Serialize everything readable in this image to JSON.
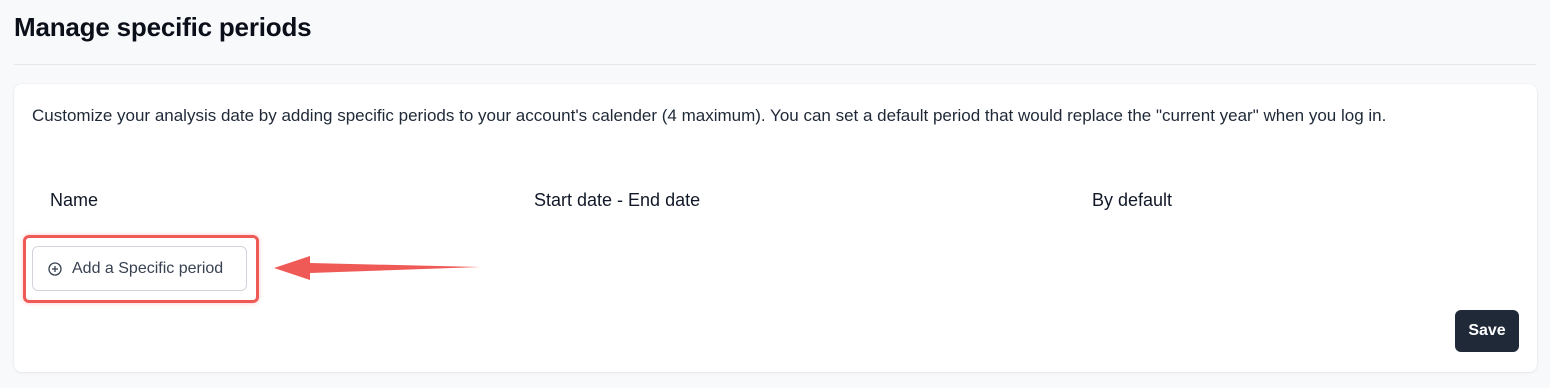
{
  "page": {
    "title": "Manage specific periods"
  },
  "card": {
    "description": "Customize your analysis date by adding specific periods to your account's calender (4 maximum). You can set a default period that would replace the \"current year\" when you log in.",
    "columns": [
      "Name",
      "Start date - End date",
      "By default"
    ],
    "add_button": {
      "label": "Add a Specific period",
      "icon": "plus-circle-icon"
    },
    "save_label": "Save"
  },
  "annotation": {
    "highlight_color": "#ef5a57",
    "arrow_icon": "arrow-left-icon"
  },
  "colors": {
    "background": "#f8f9fb",
    "card": "#ffffff",
    "primary_button": "#1f2937"
  }
}
